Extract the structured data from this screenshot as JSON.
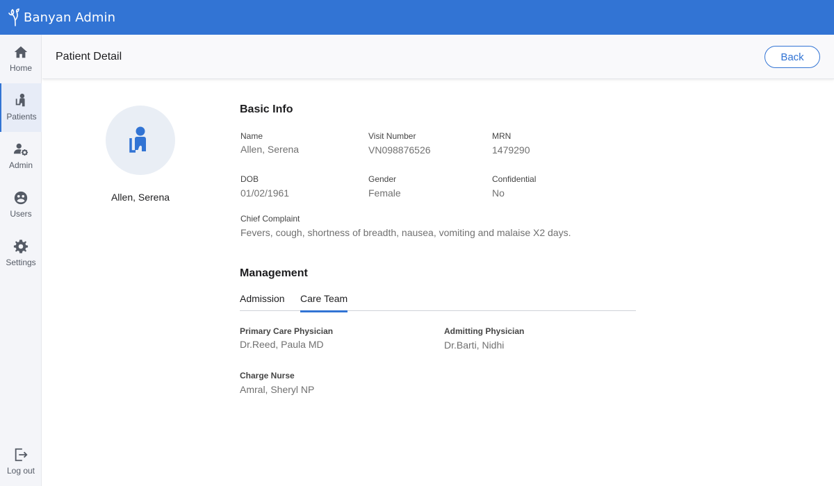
{
  "app": {
    "title": "Banyan Admin"
  },
  "sidebar": {
    "items": [
      {
        "label": "Home",
        "icon": "home-icon"
      },
      {
        "label": "Patients",
        "icon": "patient-icon",
        "active": true
      },
      {
        "label": "Admin",
        "icon": "admin-icon"
      },
      {
        "label": "Users",
        "icon": "users-icon"
      },
      {
        "label": "Settings",
        "icon": "gear-icon"
      }
    ],
    "logout": {
      "label": "Log out",
      "icon": "logout-icon"
    }
  },
  "header": {
    "title": "Patient Detail",
    "back_label": "Back"
  },
  "profile": {
    "name": "Allen, Serena",
    "icon": "patient-avatar-icon"
  },
  "basic_info": {
    "title": "Basic Info",
    "name": {
      "label": "Name",
      "value": "Allen, Serena"
    },
    "visit_number": {
      "label": "Visit Number",
      "value": "VN098876526"
    },
    "mrn": {
      "label": "MRN",
      "value": "1479290"
    },
    "dob": {
      "label": "DOB",
      "value": "01/02/1961"
    },
    "gender": {
      "label": "Gender",
      "value": "Female"
    },
    "confidential": {
      "label": "Confidential",
      "value": "No"
    },
    "chief_complaint": {
      "label": "Chief Complaint",
      "value": "Fevers, cough, shortness of breadth, nausea, vomiting and malaise X2 days."
    }
  },
  "management": {
    "title": "Management",
    "tabs": [
      {
        "label": "Admission",
        "active": false
      },
      {
        "label": "Care Team",
        "active": true
      }
    ],
    "care_team": {
      "primary_care": {
        "label": "Primary Care Physician",
        "value": "Dr.Reed, Paula MD"
      },
      "admitting": {
        "label": "Admitting Physician",
        "value": "Dr.Barti, Nidhi"
      },
      "charge_nurse": {
        "label": "Charge Nurse",
        "value": "Amral, Sheryl NP"
      }
    }
  },
  "colors": {
    "brand": "#3274d4",
    "sidebar_bg": "#f4f5f9",
    "icon": "#555b66"
  }
}
